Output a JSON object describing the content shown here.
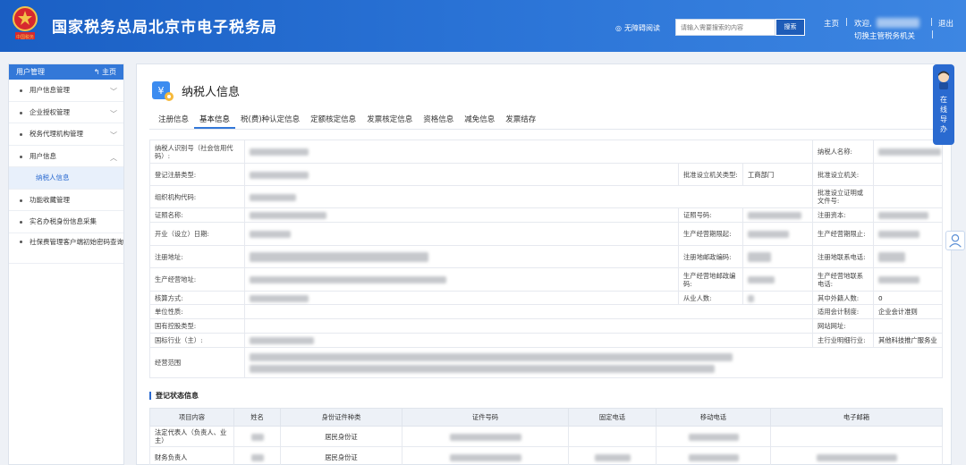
{
  "header": {
    "title": "国家税务总局北京市电子税务局",
    "emblem_text": "中国税务",
    "accessibility": "无障碍阅读",
    "search_placeholder": "请输入需要搜索的内容",
    "search_button": "搜索",
    "home": "主页",
    "separator": "|",
    "welcome": "欢迎,",
    "switch_org": "切换主管税务机关",
    "logout": "退出"
  },
  "sidebar": {
    "title": "用户管理",
    "home": "主页",
    "items": [
      {
        "label": "用户信息管理"
      },
      {
        "label": "企业授权管理"
      },
      {
        "label": "税务代理机构管理"
      },
      {
        "label": "用户信息"
      },
      {
        "label": "纳税人信息"
      },
      {
        "label": "功能收藏管理"
      },
      {
        "label": "实名办税身份信息采集"
      },
      {
        "label": "社保费管理客户端初始密码查询"
      }
    ]
  },
  "main": {
    "title": "纳税人信息",
    "tabs": [
      "注册信息",
      "基本信息",
      "税(费)种认定信息",
      "定额核定信息",
      "发票核定信息",
      "资格信息",
      "减免信息",
      "发票结存"
    ],
    "active_tab": "基本信息",
    "labels": {
      "tin": "纳税人识别号（社会信用代码）:",
      "taxpayer_name": "纳税人名称:",
      "reg_type": "登记注册类型:",
      "approve_org_type": "批准设立机关类型:",
      "approve_org_type_val": "工商部门",
      "approve_org": "批准设立机关:",
      "org_code": "组织机构代码:",
      "approve_cert": "批准设立证明或文件号:",
      "cert_name": "证照名称:",
      "cert_no": "证照号码:",
      "reg_capital": "注册资本:",
      "open_date": "开业（设立）日期:",
      "biz_start": "生产经营期限起:",
      "biz_end": "生产经营期限止:",
      "reg_addr": "注册地址:",
      "reg_zip": "注册地邮政编码:",
      "reg_phone": "注册地联系电话:",
      "biz_addr": "生产经营地址:",
      "biz_zip": "生产经营地邮政编码:",
      "biz_phone": "生产经营地联系电话:",
      "accounting": "核算方式:",
      "employees": "从业人数:",
      "foreigners": "其中外籍人数:",
      "foreigners_val": "0",
      "unit_nature": "单位性质:",
      "acct_system": "适用会计制度:",
      "acct_system_val": "企业会计准则",
      "state_holding": "国有控股类型:",
      "website": "网站网址:",
      "industry": "国标行业（主）:",
      "main_detail": "主行业明细行业:",
      "main_detail_val": "其他科技推广服务业",
      "scope": "经营范围"
    },
    "section_title": "登记状态信息",
    "persons_headers": [
      "项目内容",
      "姓名",
      "身份证件种类",
      "证件号码",
      "固定电话",
      "移动电话",
      "电子邮箱"
    ],
    "persons_rows": [
      {
        "role": "法定代表人（负责人、业主）",
        "id_type": "居民身份证"
      },
      {
        "role": "财务负责人",
        "id_type": "居民身份证"
      }
    ]
  },
  "float": {
    "online_chars": [
      "在",
      "线",
      "导",
      "办"
    ]
  },
  "colors": {
    "header_blue": "#2a73d6",
    "accent": "#3378d8"
  }
}
